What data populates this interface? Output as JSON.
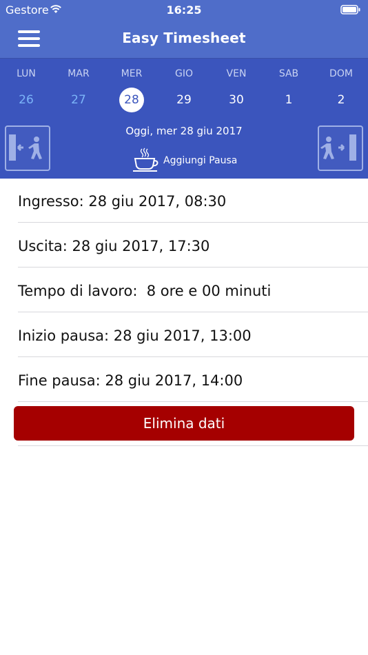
{
  "status_bar": {
    "carrier": "Gestore",
    "time": "16:25"
  },
  "nav": {
    "title": "Easy Timesheet"
  },
  "calendar": {
    "days": [
      {
        "name": "LUN",
        "number": "26"
      },
      {
        "name": "MAR",
        "number": "27"
      },
      {
        "name": "MER",
        "number": "28"
      },
      {
        "name": "GIO",
        "number": "29"
      },
      {
        "name": "VEN",
        "number": "30"
      },
      {
        "name": "SAB",
        "number": "1"
      },
      {
        "name": "DOM",
        "number": "2"
      }
    ],
    "today_label": "Oggi, mer 28 giu 2017",
    "pause_label": "Aggiungi Pausa"
  },
  "entries": {
    "check_in": "Ingresso: 28 giu 2017, 08:30",
    "check_out": "Uscita: 28 giu 2017, 17:30",
    "work_time": "Tempo di lavoro:  8 ore e 00 minuti",
    "pause_start": "Inizio pausa: 28 giu 2017, 13:00",
    "pause_end": "Fine pausa: 28 giu 2017, 14:00"
  },
  "actions": {
    "delete_label": "Elimina dati"
  },
  "colors": {
    "nav_bg": "#4f6dc9",
    "calendar_bg": "#3b55bd",
    "past_day": "#7bb4f8",
    "delete_button": "#a50000"
  }
}
